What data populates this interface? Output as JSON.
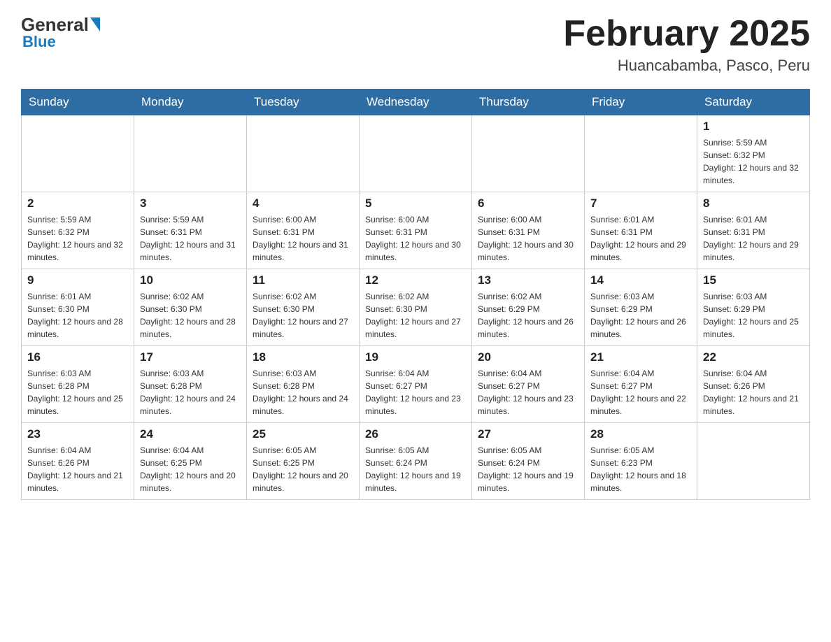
{
  "logo": {
    "general": "General",
    "blue": "Blue"
  },
  "header": {
    "month": "February 2025",
    "location": "Huancabamba, Pasco, Peru"
  },
  "weekdays": [
    "Sunday",
    "Monday",
    "Tuesday",
    "Wednesday",
    "Thursday",
    "Friday",
    "Saturday"
  ],
  "weeks": [
    [
      {
        "day": "",
        "sunrise": "",
        "sunset": "",
        "daylight": ""
      },
      {
        "day": "",
        "sunrise": "",
        "sunset": "",
        "daylight": ""
      },
      {
        "day": "",
        "sunrise": "",
        "sunset": "",
        "daylight": ""
      },
      {
        "day": "",
        "sunrise": "",
        "sunset": "",
        "daylight": ""
      },
      {
        "day": "",
        "sunrise": "",
        "sunset": "",
        "daylight": ""
      },
      {
        "day": "",
        "sunrise": "",
        "sunset": "",
        "daylight": ""
      },
      {
        "day": "1",
        "sunrise": "Sunrise: 5:59 AM",
        "sunset": "Sunset: 6:32 PM",
        "daylight": "Daylight: 12 hours and 32 minutes."
      }
    ],
    [
      {
        "day": "2",
        "sunrise": "Sunrise: 5:59 AM",
        "sunset": "Sunset: 6:32 PM",
        "daylight": "Daylight: 12 hours and 32 minutes."
      },
      {
        "day": "3",
        "sunrise": "Sunrise: 5:59 AM",
        "sunset": "Sunset: 6:31 PM",
        "daylight": "Daylight: 12 hours and 31 minutes."
      },
      {
        "day": "4",
        "sunrise": "Sunrise: 6:00 AM",
        "sunset": "Sunset: 6:31 PM",
        "daylight": "Daylight: 12 hours and 31 minutes."
      },
      {
        "day": "5",
        "sunrise": "Sunrise: 6:00 AM",
        "sunset": "Sunset: 6:31 PM",
        "daylight": "Daylight: 12 hours and 30 minutes."
      },
      {
        "day": "6",
        "sunrise": "Sunrise: 6:00 AM",
        "sunset": "Sunset: 6:31 PM",
        "daylight": "Daylight: 12 hours and 30 minutes."
      },
      {
        "day": "7",
        "sunrise": "Sunrise: 6:01 AM",
        "sunset": "Sunset: 6:31 PM",
        "daylight": "Daylight: 12 hours and 29 minutes."
      },
      {
        "day": "8",
        "sunrise": "Sunrise: 6:01 AM",
        "sunset": "Sunset: 6:31 PM",
        "daylight": "Daylight: 12 hours and 29 minutes."
      }
    ],
    [
      {
        "day": "9",
        "sunrise": "Sunrise: 6:01 AM",
        "sunset": "Sunset: 6:30 PM",
        "daylight": "Daylight: 12 hours and 28 minutes."
      },
      {
        "day": "10",
        "sunrise": "Sunrise: 6:02 AM",
        "sunset": "Sunset: 6:30 PM",
        "daylight": "Daylight: 12 hours and 28 minutes."
      },
      {
        "day": "11",
        "sunrise": "Sunrise: 6:02 AM",
        "sunset": "Sunset: 6:30 PM",
        "daylight": "Daylight: 12 hours and 27 minutes."
      },
      {
        "day": "12",
        "sunrise": "Sunrise: 6:02 AM",
        "sunset": "Sunset: 6:30 PM",
        "daylight": "Daylight: 12 hours and 27 minutes."
      },
      {
        "day": "13",
        "sunrise": "Sunrise: 6:02 AM",
        "sunset": "Sunset: 6:29 PM",
        "daylight": "Daylight: 12 hours and 26 minutes."
      },
      {
        "day": "14",
        "sunrise": "Sunrise: 6:03 AM",
        "sunset": "Sunset: 6:29 PM",
        "daylight": "Daylight: 12 hours and 26 minutes."
      },
      {
        "day": "15",
        "sunrise": "Sunrise: 6:03 AM",
        "sunset": "Sunset: 6:29 PM",
        "daylight": "Daylight: 12 hours and 25 minutes."
      }
    ],
    [
      {
        "day": "16",
        "sunrise": "Sunrise: 6:03 AM",
        "sunset": "Sunset: 6:28 PM",
        "daylight": "Daylight: 12 hours and 25 minutes."
      },
      {
        "day": "17",
        "sunrise": "Sunrise: 6:03 AM",
        "sunset": "Sunset: 6:28 PM",
        "daylight": "Daylight: 12 hours and 24 minutes."
      },
      {
        "day": "18",
        "sunrise": "Sunrise: 6:03 AM",
        "sunset": "Sunset: 6:28 PM",
        "daylight": "Daylight: 12 hours and 24 minutes."
      },
      {
        "day": "19",
        "sunrise": "Sunrise: 6:04 AM",
        "sunset": "Sunset: 6:27 PM",
        "daylight": "Daylight: 12 hours and 23 minutes."
      },
      {
        "day": "20",
        "sunrise": "Sunrise: 6:04 AM",
        "sunset": "Sunset: 6:27 PM",
        "daylight": "Daylight: 12 hours and 23 minutes."
      },
      {
        "day": "21",
        "sunrise": "Sunrise: 6:04 AM",
        "sunset": "Sunset: 6:27 PM",
        "daylight": "Daylight: 12 hours and 22 minutes."
      },
      {
        "day": "22",
        "sunrise": "Sunrise: 6:04 AM",
        "sunset": "Sunset: 6:26 PM",
        "daylight": "Daylight: 12 hours and 21 minutes."
      }
    ],
    [
      {
        "day": "23",
        "sunrise": "Sunrise: 6:04 AM",
        "sunset": "Sunset: 6:26 PM",
        "daylight": "Daylight: 12 hours and 21 minutes."
      },
      {
        "day": "24",
        "sunrise": "Sunrise: 6:04 AM",
        "sunset": "Sunset: 6:25 PM",
        "daylight": "Daylight: 12 hours and 20 minutes."
      },
      {
        "day": "25",
        "sunrise": "Sunrise: 6:05 AM",
        "sunset": "Sunset: 6:25 PM",
        "daylight": "Daylight: 12 hours and 20 minutes."
      },
      {
        "day": "26",
        "sunrise": "Sunrise: 6:05 AM",
        "sunset": "Sunset: 6:24 PM",
        "daylight": "Daylight: 12 hours and 19 minutes."
      },
      {
        "day": "27",
        "sunrise": "Sunrise: 6:05 AM",
        "sunset": "Sunset: 6:24 PM",
        "daylight": "Daylight: 12 hours and 19 minutes."
      },
      {
        "day": "28",
        "sunrise": "Sunrise: 6:05 AM",
        "sunset": "Sunset: 6:23 PM",
        "daylight": "Daylight: 12 hours and 18 minutes."
      },
      {
        "day": "",
        "sunrise": "",
        "sunset": "",
        "daylight": ""
      }
    ]
  ]
}
